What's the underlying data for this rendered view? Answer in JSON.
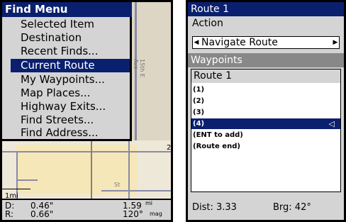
{
  "find_menu": {
    "title": "Find Menu",
    "items": [
      {
        "label": "Selected Item"
      },
      {
        "label": "Destination"
      },
      {
        "label": "Recent Finds..."
      },
      {
        "label": "Current Route",
        "selected": true
      },
      {
        "label": "My Waypoints..."
      },
      {
        "label": "Map Places..."
      },
      {
        "label": "Highway Exits..."
      },
      {
        "label": "Find Streets..."
      },
      {
        "label": "Find Address..."
      }
    ]
  },
  "map": {
    "road_label": "15th E Ave",
    "road_label_2": "St",
    "scale_label": "1mi",
    "scale_digit": "2"
  },
  "status": {
    "d_label": "D:",
    "d_value": "0.46\"",
    "r_label": "R:",
    "r_value": "0.66\"",
    "dist_value": "1.59",
    "dist_unit": "mi",
    "brg_value": "120°",
    "brg_unit": "mag"
  },
  "route": {
    "title": "Route 1",
    "action_label": "Action",
    "action_value": "Navigate Route",
    "waypoints_header": "Waypoints",
    "list_title": "Route 1",
    "rows": [
      {
        "label": "(1)"
      },
      {
        "label": "(2)"
      },
      {
        "label": "(3)"
      },
      {
        "label": "(4)",
        "selected": true
      },
      {
        "label": "(ENT to add)"
      },
      {
        "label": "(Route end)"
      }
    ],
    "dist": "Dist: 3.33",
    "brg": "Brg: 42°"
  }
}
